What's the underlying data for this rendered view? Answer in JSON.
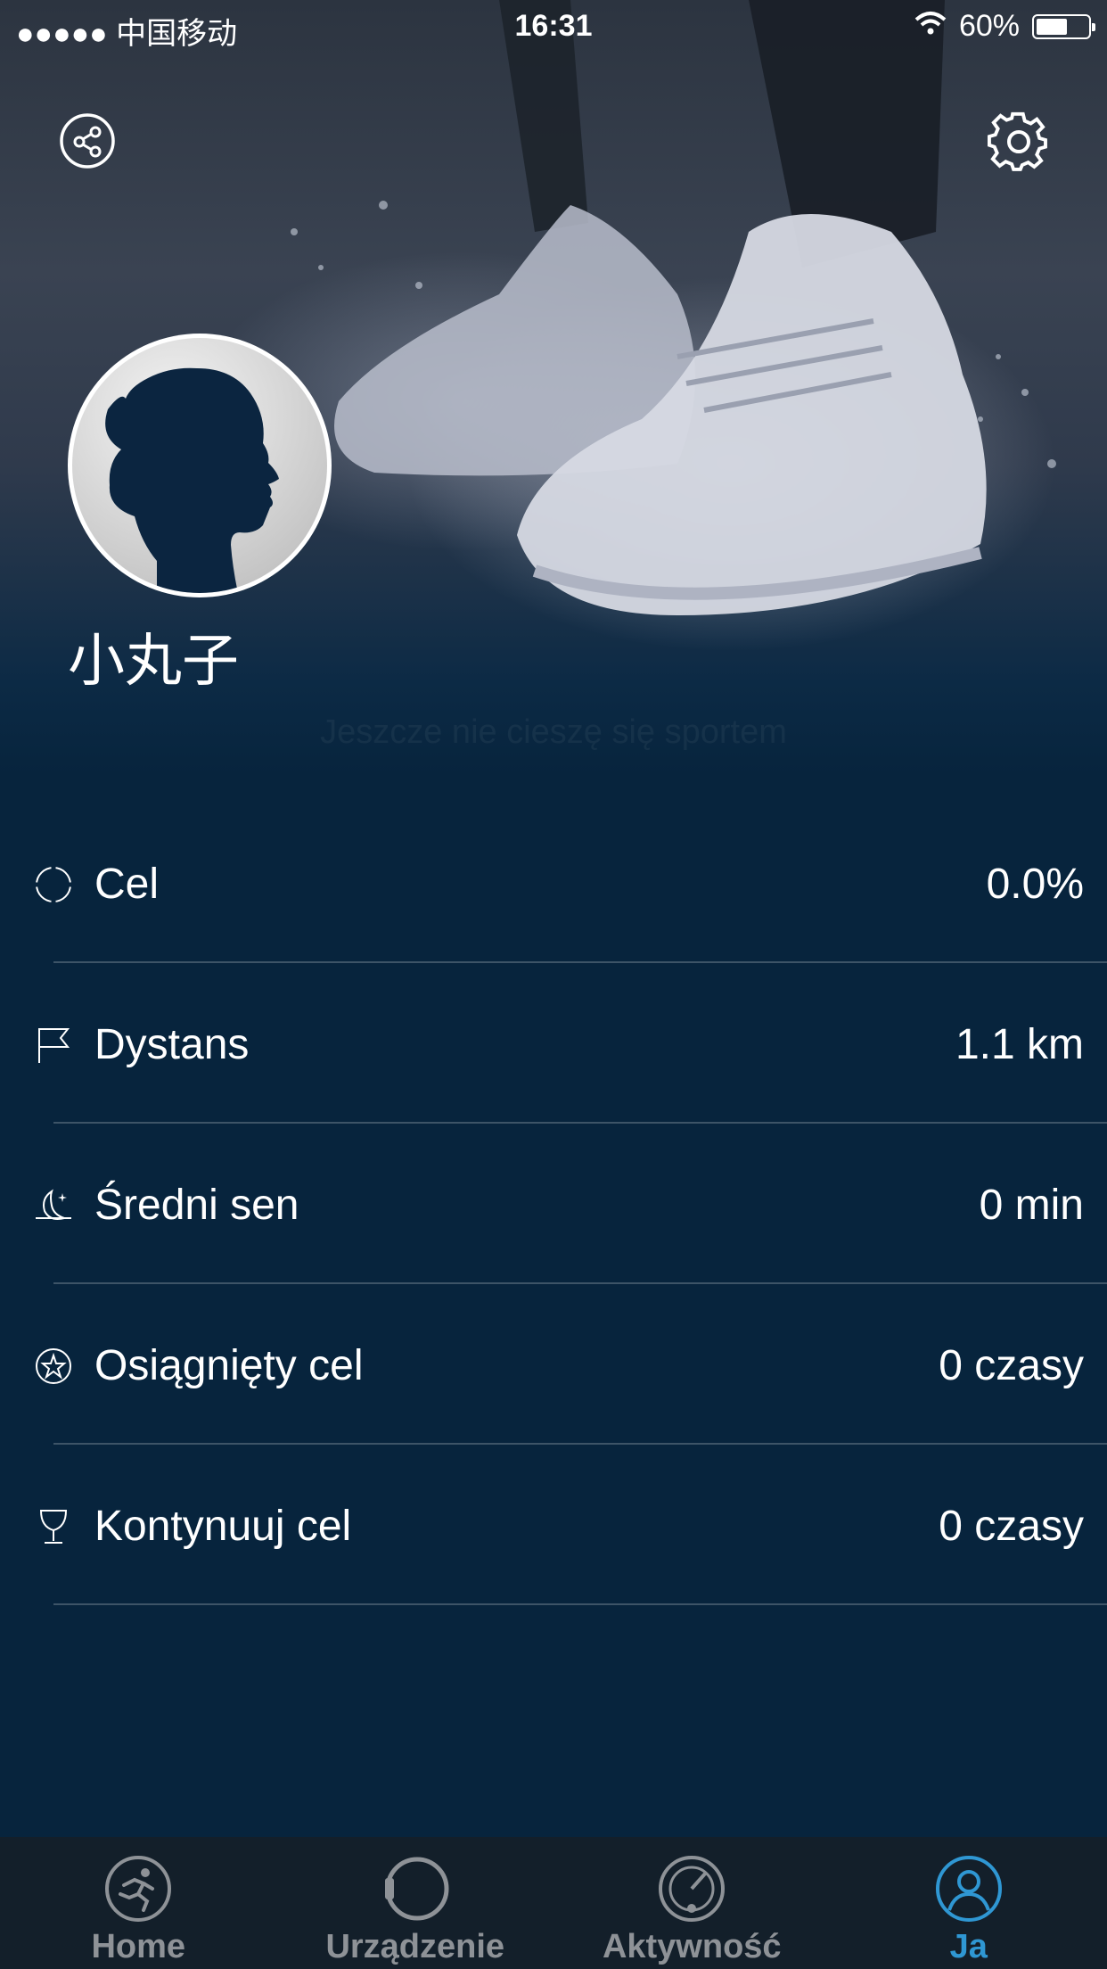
{
  "status_bar": {
    "carrier": "●●●●● 中国移动",
    "time": "16:31",
    "battery": "60%"
  },
  "header": {
    "share_icon": "share-icon",
    "settings_icon": "gear-icon"
  },
  "profile": {
    "username": "小丸子",
    "hint": "Jeszcze nie cieszę się sportem"
  },
  "stats": [
    {
      "icon": "target-icon",
      "label": "Cel",
      "value": "0.0%"
    },
    {
      "icon": "flag-icon",
      "label": "Dystans",
      "value": "1.1 km"
    },
    {
      "icon": "moon-icon",
      "label": "Średni sen",
      "value": "0 min"
    },
    {
      "icon": "star-icon",
      "label": "Osiągnięty cel",
      "value": "0 czasy"
    },
    {
      "icon": "trophy-icon",
      "label": "Kontynuuj cel",
      "value": "0 czasy"
    }
  ],
  "tabbar": {
    "tabs": [
      {
        "icon": "runner-icon",
        "label": "Home",
        "active": false
      },
      {
        "icon": "watch-icon",
        "label": "Urządzenie",
        "active": false
      },
      {
        "icon": "gauge-icon",
        "label": "Aktywność",
        "active": false
      },
      {
        "icon": "user-icon",
        "label": "Ja",
        "active": true
      }
    ]
  },
  "colors": {
    "background": "#07243d",
    "tabbar": "#131f2a",
    "active_tab": "#2f97d3",
    "inactive_tab": "#8e9297"
  }
}
